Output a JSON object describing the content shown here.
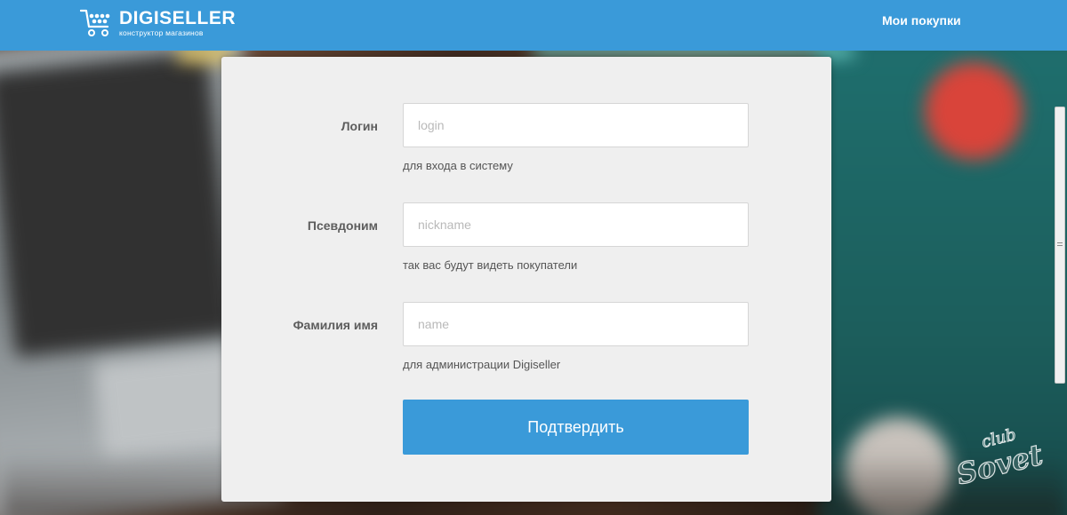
{
  "header": {
    "logo_name": "DIGISELLER",
    "logo_tagline": "конструктор магазинов",
    "nav_link": "Мои покупки",
    "background_color": "#3a9ad9"
  },
  "form": {
    "fields": [
      {
        "label": "Логин",
        "placeholder": "login",
        "value": "",
        "hint": "для входа в систему"
      },
      {
        "label": "Псевдоним",
        "placeholder": "nickname",
        "value": "",
        "hint": "так вас будут видеть покупатели"
      },
      {
        "label": "Фамилия имя",
        "placeholder": "name",
        "value": "",
        "hint": "для администрации Digiseller"
      }
    ],
    "submit_label": "Подтвердить",
    "accent_color": "#3a9ad9"
  },
  "watermark": {
    "line1": "club",
    "line2": "Sovet"
  },
  "icons": {
    "logo": "shopping-cart-icon",
    "scroll_grip": "grip-lines-icon"
  }
}
